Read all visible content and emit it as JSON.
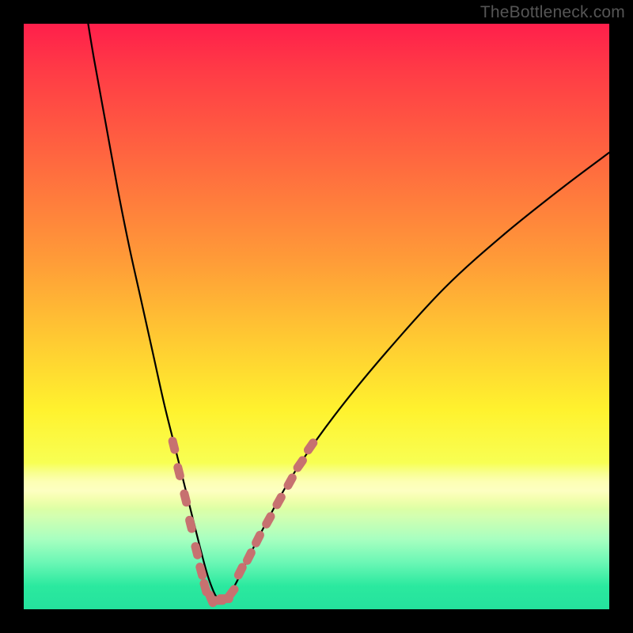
{
  "attribution": "TheBottleneck.com",
  "colors": {
    "curve": "#000000",
    "markers": "#c77170",
    "frame_bg": "#000000"
  },
  "chart_data": {
    "type": "line",
    "title": "",
    "xlabel": "",
    "ylabel": "",
    "xlim": [
      0,
      100
    ],
    "ylim": [
      0,
      100
    ],
    "grid": false,
    "legend": false,
    "annotations": [],
    "series": [
      {
        "name": "bottleneck-curve",
        "description": "V-shaped curve; y ≈ 100 at edges, ≈ 0 near x ≈ 33",
        "x": [
          11.0,
          12.0,
          14.0,
          16.0,
          18.0,
          20.0,
          22.0,
          24.0,
          26.0,
          28.0,
          30.0,
          31.5,
          33.0,
          34.5,
          36.0,
          38.0,
          41.0,
          46.0,
          53.0,
          62.0,
          72.0,
          82.0,
          92.0,
          100.0
        ],
        "y": [
          100.0,
          94.0,
          83.0,
          72.0,
          62.0,
          53.0,
          44.0,
          35.0,
          27.0,
          19.0,
          11.0,
          5.5,
          2.0,
          2.0,
          4.0,
          8.0,
          14.0,
          23.0,
          33.0,
          44.0,
          55.0,
          64.0,
          72.0,
          78.0
        ]
      }
    ],
    "markers": [
      {
        "name": "left-band-markers",
        "x": [
          25.6,
          26.5,
          27.6,
          28.5,
          29.5,
          30.3,
          31.0
        ],
        "y": [
          28.0,
          23.5,
          19.0,
          14.5,
          10.0,
          6.5,
          3.7
        ]
      },
      {
        "name": "bottom-markers",
        "x": [
          32.0,
          33.2,
          34.3,
          35.5
        ],
        "y": [
          1.8,
          1.5,
          1.8,
          2.8
        ]
      },
      {
        "name": "right-band-markers",
        "x": [
          37.0,
          38.5,
          40.0,
          41.8,
          43.6,
          45.5,
          47.2,
          49.0
        ],
        "y": [
          6.5,
          9.0,
          12.0,
          15.2,
          18.5,
          21.8,
          24.8,
          27.8
        ]
      }
    ]
  }
}
